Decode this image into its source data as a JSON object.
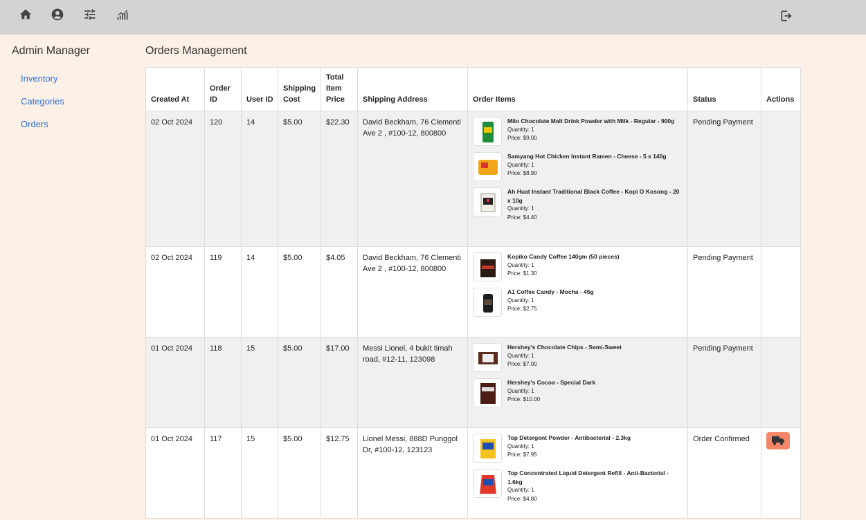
{
  "topbar": {
    "icons": [
      "home-icon",
      "account-icon",
      "tune-icon",
      "analytics-icon"
    ],
    "logout_icon": "logout-icon"
  },
  "sidebar": {
    "title": "Admin Manager",
    "links": [
      "Inventory",
      "Categories",
      "Orders"
    ]
  },
  "main": {
    "title": "Orders Management",
    "columns": [
      "Created At",
      "Order ID",
      "User ID",
      "Shipping Cost",
      "Total Item Price",
      "Shipping Address",
      "Order Items",
      "Status",
      "Actions"
    ],
    "orders": [
      {
        "created_at": "02 Oct 2024",
        "order_id": "120",
        "user_id": "14",
        "shipping": "$5.00",
        "total": "$22.30",
        "address": "David Beckham, 76 Clementi Ave 2 , #100-12, 800800",
        "status": "Pending Payment",
        "items": [
          {
            "name": "Milo Chocolate Malt Drink Powder with Milk - Regular - 900g",
            "qty": "Quantity: 1",
            "price": "Price: $9.00"
          },
          {
            "name": "Samyang Hot Chicken Instant Ramen - Cheese - 5 x 140g",
            "qty": "Quantity: 1",
            "price": "Price: $8.90"
          },
          {
            "name": "Ah Huat Instant Traditional Black Coffee - Kopi O Kosong - 20 x 10g",
            "qty": "Quantity: 1",
            "price": "Price: $4.40"
          }
        ]
      },
      {
        "created_at": "02 Oct 2024",
        "order_id": "119",
        "user_id": "14",
        "shipping": "$5.00",
        "total": "$4.05",
        "address": "David Beckham, 76 Clementi Ave 2 , #100-12, 800800",
        "status": "Pending Payment",
        "items": [
          {
            "name": "Kopiko Candy Coffee 140gm (50 pieces)",
            "qty": "Quantity: 1",
            "price": "Price: $1.30"
          },
          {
            "name": "A1 Coffee Candy - Mocha - 45g",
            "qty": "Quantity: 1",
            "price": "Price: $2.75"
          }
        ]
      },
      {
        "created_at": "01 Oct 2024",
        "order_id": "118",
        "user_id": "15",
        "shipping": "$5.00",
        "total": "$17.00",
        "address": "Messi Lionel, 4 bukit timah road, #12-11, 123098",
        "status": "Pending Payment",
        "items": [
          {
            "name": "Hershey's Chocolate Chips - Semi-Sweet",
            "qty": "Quantity: 1",
            "price": "Price: $7.00"
          },
          {
            "name": "Hershey's Cocoa - Special Dark",
            "qty": "Quantity: 1",
            "price": "Price: $10.00"
          }
        ]
      },
      {
        "created_at": "01 Oct 2024",
        "order_id": "117",
        "user_id": "15",
        "shipping": "$5.00",
        "total": "$12.75",
        "address": "Lionel Messi, 888D Punggol Dr, #100-12, 123123",
        "status": "Order Confirmed",
        "action_icon": "truck-icon",
        "items": [
          {
            "name": "Top Detergent Powder - Antibacterial - 2.3kg",
            "qty": "Quantity: 1",
            "price": "Price: $7.95"
          },
          {
            "name": "Top Concentrated Liquid Detergent Refill - Anti-Bacterial - 1.6kg",
            "qty": "Quantity: 1",
            "price": "Price: $4.80"
          }
        ]
      }
    ]
  },
  "colors": {
    "topbar": "#d3d3d3",
    "background": "#fdf0e6",
    "link": "#2a6fd6",
    "action_button": "#f4866a"
  }
}
